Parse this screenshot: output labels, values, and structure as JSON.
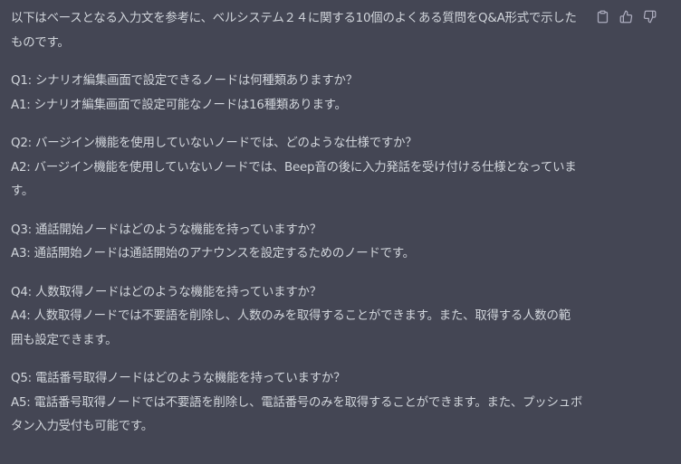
{
  "message": {
    "intro": [
      "以下はベースとなる入力文を参考に、ベルシステム２４に関する10個のよくある質問をQ&A形式で示した",
      "ものです。"
    ],
    "qa": [
      {
        "q": [
          "Q1: シナリオ編集画面で設定できるノードは何種類ありますか？"
        ],
        "a": [
          "A1: シナリオ編集画面で設定可能なノードは16種類あります。"
        ]
      },
      {
        "q": [
          "Q2: バージイン機能を使用していないノードでは、どのような仕様ですか？"
        ],
        "a": [
          "A2: バージイン機能を使用していないノードでは、Beep音の後に入力発話を受け付ける仕様となっていま",
          "す。"
        ]
      },
      {
        "q": [
          "Q3: 通話開始ノードはどのような機能を持っていますか？"
        ],
        "a": [
          "A3: 通話開始ノードは通話開始のアナウンスを設定するためのノードです。"
        ]
      },
      {
        "q": [
          "Q4: 人数取得ノードはどのような機能を持っていますか？"
        ],
        "a": [
          "A4: 人数取得ノードでは不要語を削除し、人数のみを取得することができます。また、取得する人数の範",
          "囲も設定できます。"
        ]
      },
      {
        "q": [
          "Q5: 電話番号取得ノードはどのような機能を持っていますか？"
        ],
        "a": [
          "A5: 電話番号取得ノードでは不要語を削除し、電話番号のみを取得することができます。また、プッシュボ",
          "タン入力受付も可能です。"
        ]
      }
    ]
  },
  "actions": [
    {
      "name": "copy-button",
      "icon": "clipboard-icon"
    },
    {
      "name": "thumbs-up-button",
      "icon": "thumbs-up-icon"
    },
    {
      "name": "thumbs-down-button",
      "icon": "thumbs-down-icon"
    }
  ],
  "colors": {
    "background": "#444654",
    "text": "#d1d5db",
    "icon": "#acacbe"
  }
}
